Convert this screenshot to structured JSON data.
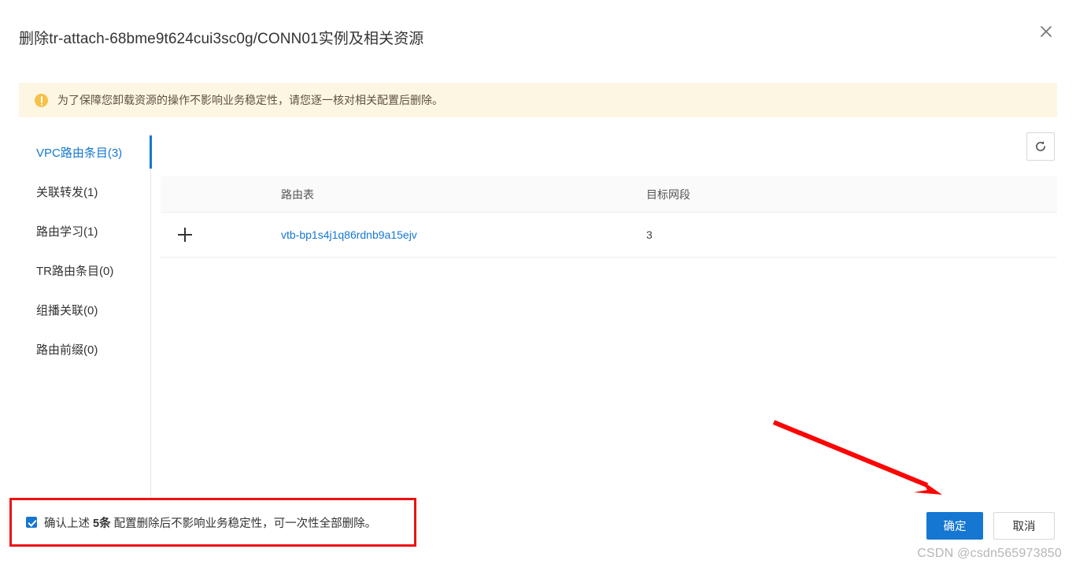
{
  "dialog": {
    "title": "删除tr-attach-68bme9t624cui3sc0g/CONN01实例及相关资源",
    "close_icon": "close-icon"
  },
  "banner": {
    "icon": "warning-circle-icon",
    "text": "为了保障您卸载资源的操作不影响业务稳定性，请您逐一核对相关配置后删除。",
    "background": "#fdf6e3",
    "icon_color": "#f5c149"
  },
  "sidebar": {
    "active_index": 0,
    "accent": "#1677d2",
    "items": [
      {
        "label": "VPC路由条目(3)",
        "name": "vpc-route-entries",
        "count": 3
      },
      {
        "label": "关联转发(1)",
        "name": "association-forwarding",
        "count": 1
      },
      {
        "label": "路由学习(1)",
        "name": "route-learning",
        "count": 1
      },
      {
        "label": "TR路由条目(0)",
        "name": "tr-route-entries",
        "count": 0
      },
      {
        "label": "组播关联(0)",
        "name": "multicast-association",
        "count": 0
      },
      {
        "label": "路由前缀(0)",
        "name": "route-prefix",
        "count": 0
      }
    ]
  },
  "content": {
    "refresh_icon": "refresh-icon",
    "table": {
      "columns": [
        "路由表",
        "目标网段"
      ],
      "rows": [
        {
          "expand_icon": "plus-icon",
          "route_table": "vtb-bp1s4j1q86rdnb9a15ejv",
          "destination_cidr": "3"
        }
      ]
    }
  },
  "footer": {
    "checkbox_checked": true,
    "confirm_text_before": "确认上述 ",
    "confirm_count": "5条",
    "confirm_text_after": " 配置删除后不影响业务稳定性，可一次性全部删除。",
    "ok_label": "确定",
    "cancel_label": "取消",
    "highlight_color": "#ee1111"
  },
  "annotation": {
    "arrow_color": "#fb0505",
    "arrow_name": "red-pointer-arrow"
  },
  "watermark": {
    "text": "CSDN @csdn565973850"
  }
}
